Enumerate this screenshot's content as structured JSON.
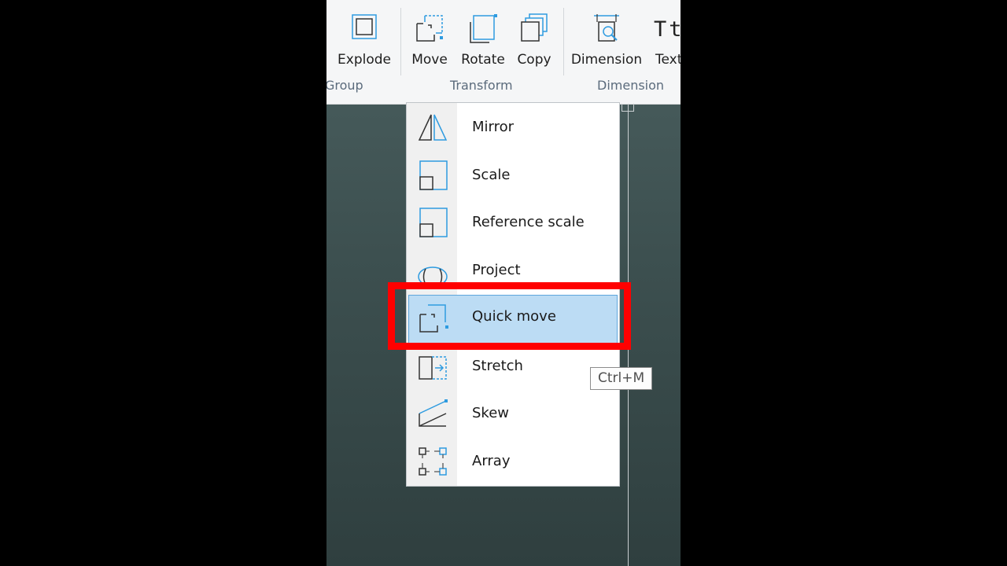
{
  "ribbon": {
    "buttons": [
      {
        "label": "Explode",
        "icon": "explode-icon"
      },
      {
        "label": "Move",
        "icon": "move-icon"
      },
      {
        "label": "Rotate",
        "icon": "rotate-icon"
      },
      {
        "label": "Copy",
        "icon": "copy-icon"
      },
      {
        "label": "Dimension",
        "icon": "dimension-icon"
      },
      {
        "label": "Text",
        "icon": "text-icon"
      }
    ],
    "text_icon_glyph": "Tt",
    "groups": [
      "Group",
      "Transform",
      "Dimension"
    ]
  },
  "menu": {
    "items": [
      {
        "label": "Mirror",
        "icon": "mirror-icon"
      },
      {
        "label": "Scale",
        "icon": "scale-icon"
      },
      {
        "label": "Reference scale",
        "icon": "reference-scale-icon"
      },
      {
        "label": "Project",
        "icon": "project-icon"
      },
      {
        "label": "Quick move",
        "icon": "quick-move-icon",
        "selected": true
      },
      {
        "label": "Stretch",
        "icon": "stretch-icon"
      },
      {
        "label": "Skew",
        "icon": "skew-icon"
      },
      {
        "label": "Array",
        "icon": "array-icon"
      }
    ]
  },
  "tooltip": "Ctrl+M",
  "colors": {
    "accent": "#2e9be0",
    "selection": "#bcdcf4",
    "highlight": "#ff0000",
    "canvas": "#3d5050"
  }
}
